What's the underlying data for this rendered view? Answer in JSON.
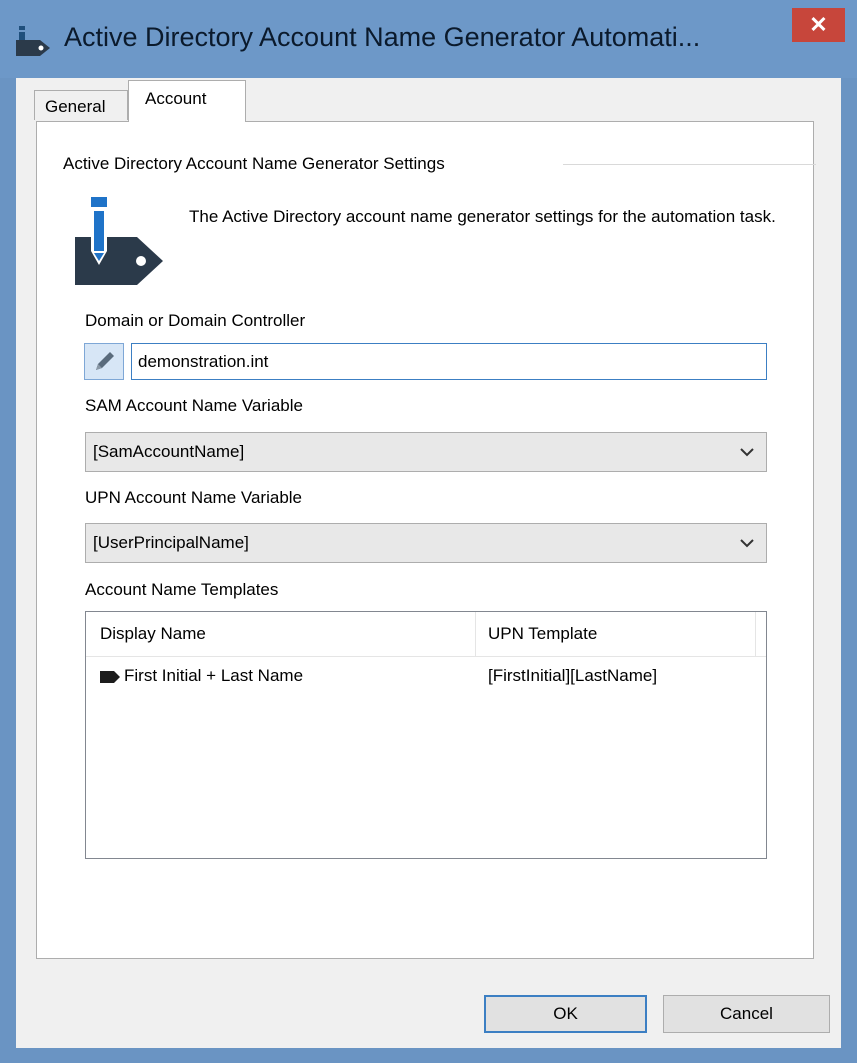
{
  "window": {
    "title": "Active Directory Account Name Generator Automati...",
    "close_label": "✕"
  },
  "tabs": [
    {
      "label": "General",
      "selected": false
    },
    {
      "label": "Account",
      "selected": true
    }
  ],
  "settings": {
    "group_title": "Active Directory Account Name Generator Settings",
    "description": "The Active Directory account name generator settings for the automation task."
  },
  "domain": {
    "label": "Domain or Domain Controller",
    "value": "demonstration.int"
  },
  "sam": {
    "label": "SAM Account Name Variable",
    "value": "[SamAccountName]"
  },
  "upn": {
    "label": "UPN Account Name Variable",
    "value": "[UserPrincipalName]"
  },
  "templates": {
    "label": "Account Name Templates",
    "columns": [
      "Display Name",
      "UPN Template"
    ],
    "rows": [
      {
        "display_name": "First Initial + Last Name",
        "upn_template": "[FirstInitial][LastName]"
      }
    ]
  },
  "buttons": {
    "ok": "OK",
    "cancel": "Cancel"
  },
  "colors": {
    "titlebar": "#6d98c8",
    "close": "#c7463b",
    "focus": "#3c7fc3",
    "icon_blue": "#1f73c8",
    "icon_dark": "#2b3a4a"
  }
}
